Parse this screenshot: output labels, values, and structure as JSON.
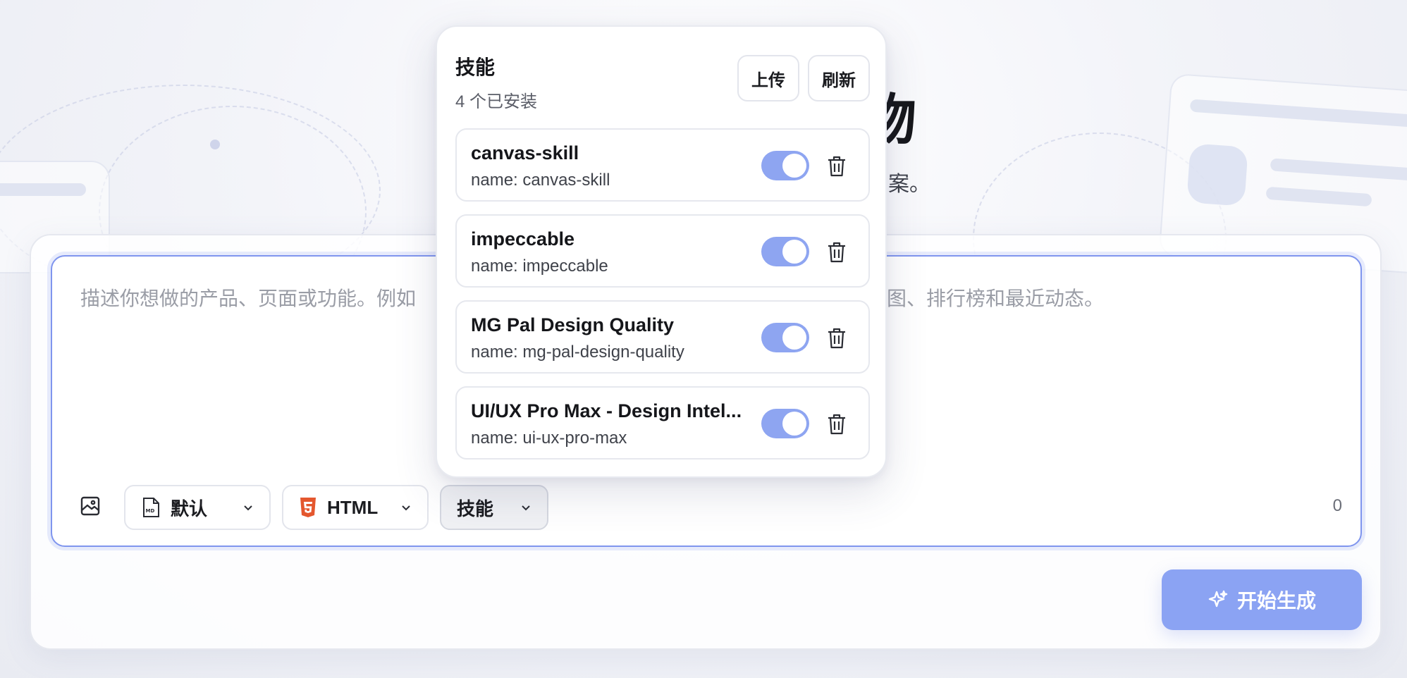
{
  "hero": {
    "title": "物",
    "subtitle": "案。"
  },
  "composer": {
    "placeholder": "描述你想做的产品、页面或功能。例如",
    "placeholder_tail": "图、排行榜和最近动态。",
    "char_count": "0",
    "chips": {
      "format": "默认",
      "output": "HTML",
      "skills": "技能"
    }
  },
  "generate_button": "开始生成",
  "skills_popover": {
    "title": "技能",
    "subtitle": "4 个已安装",
    "upload_label": "上传",
    "refresh_label": "刷新",
    "items": [
      {
        "name": "canvas-skill",
        "id": "name: canvas-skill",
        "enabled": true
      },
      {
        "name": "impeccable",
        "id": "name: impeccable",
        "enabled": true
      },
      {
        "name": "MG Pal Design Quality",
        "id": "name: mg-pal-design-quality",
        "enabled": true
      },
      {
        "name": "UI/UX Pro Max - Design Intel...",
        "id": "name: ui-ux-pro-max",
        "enabled": true
      }
    ]
  },
  "colors": {
    "accent": "#8ba3f3",
    "composer_border": "#7f95ee",
    "html_icon": "#e4572e"
  }
}
